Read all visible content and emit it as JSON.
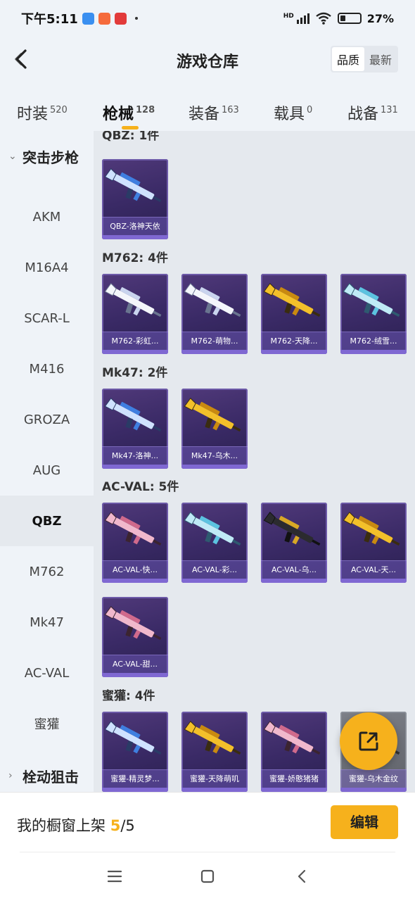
{
  "status": {
    "time": "下午5:11",
    "network": "HD",
    "battery": "27%",
    "battery_level": 0.27,
    "app_colors": [
      "#3a8ff0",
      "#f56b3c",
      "#e23a3a"
    ]
  },
  "header": {
    "title": "游戏仓库",
    "sort": [
      "品质",
      "最新"
    ],
    "sort_active": 0
  },
  "tabs": [
    {
      "label": "时装",
      "count": "520"
    },
    {
      "label": "枪械",
      "count": "128"
    },
    {
      "label": "装备",
      "count": "163"
    },
    {
      "label": "载具",
      "count": "0"
    },
    {
      "label": "战备",
      "count": "131"
    }
  ],
  "active_tab": 1,
  "sidebar": {
    "group_expanded": "突击步枪",
    "items": [
      "AKM",
      "M16A4",
      "SCAR-L",
      "M416",
      "GROZA",
      "AUG",
      "QBZ",
      "M762",
      "Mk47",
      "AC-VAL",
      "蜜獾"
    ],
    "selected": "QBZ",
    "group_collapsed": "栓动狙击"
  },
  "sections": [
    {
      "heading": "QBZ: 1件",
      "items": [
        {
          "name": "QBZ-洛神天依",
          "theme": "blue"
        }
      ]
    },
    {
      "heading": "M762: 4件",
      "items": [
        {
          "name": "M762-彩虹...",
          "theme": "white"
        },
        {
          "name": "M762-萌物...",
          "theme": "white"
        },
        {
          "name": "M762-天降...",
          "theme": "gold"
        },
        {
          "name": "M762-绒雪...",
          "theme": "cyan"
        }
      ]
    },
    {
      "heading": "Mk47: 2件",
      "items": [
        {
          "name": "Mk47-洛神...",
          "theme": "blue"
        },
        {
          "name": "Mk47-乌木...",
          "theme": "gold"
        }
      ]
    },
    {
      "heading": "AC-VAL: 5件",
      "items": [
        {
          "name": "AC-VAL-快...",
          "theme": "pink"
        },
        {
          "name": "AC-VAL-彩...",
          "theme": "cyan"
        },
        {
          "name": "AC-VAL-乌...",
          "theme": "black"
        },
        {
          "name": "AC-VAL-天...",
          "theme": "gold"
        },
        {
          "name": "AC-VAL-甜...",
          "theme": "pink"
        }
      ]
    },
    {
      "heading": "蜜獾: 4件",
      "items": [
        {
          "name": "蜜獾-精灵梦...",
          "theme": "blue"
        },
        {
          "name": "蜜獾-天降萌叽",
          "theme": "gold"
        },
        {
          "name": "蜜獾-娇憨猪猪",
          "theme": "pink"
        },
        {
          "name": "蜜獾-乌木金纹",
          "theme": "gray"
        }
      ]
    }
  ],
  "footer": {
    "showcase_prefix": "我的橱窗上架",
    "showcase_count": "5",
    "showcase_total": "/5",
    "edit_label": "编辑"
  },
  "fab_icon": "share-external-icon",
  "colors": {
    "accent": "#f6b11c",
    "card_bg": "#3a2a66",
    "card_border": "#6d5aa8"
  },
  "icons": {
    "back": "back-arrow-icon",
    "expand": "chevron-down-icon",
    "collapse": "chevron-right-icon",
    "nav_menu": "menu-icon",
    "nav_home": "home-square-icon",
    "nav_back": "nav-back-icon"
  }
}
